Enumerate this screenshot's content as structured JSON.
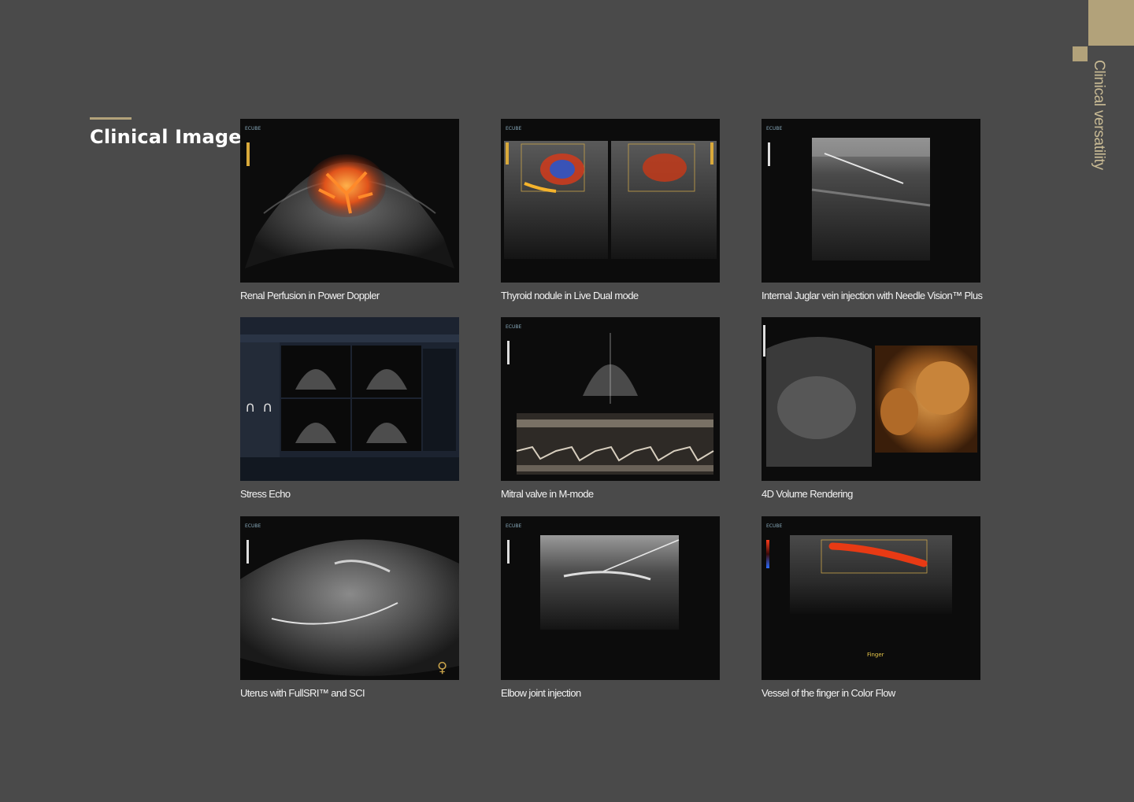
{
  "side_tab": {
    "label": "Clinical versatility"
  },
  "section": {
    "title": "Clinical Image"
  },
  "images": [
    {
      "caption": "Renal Perfusion in Power Doppler",
      "brand": "ECUBE",
      "icon": "ultrasound-scan"
    },
    {
      "caption": "Thyroid nodule in Live Dual mode",
      "brand": "ECUBE",
      "icon": "ultrasound-scan"
    },
    {
      "caption": "Internal Juglar vein injection with Needle Vision™ Plus",
      "brand": "ECUBE",
      "icon": "ultrasound-scan"
    },
    {
      "caption": "Stress Echo",
      "icon": "ultrasound-scan"
    },
    {
      "caption": "Mitral valve in M-mode",
      "brand": "ECUBE",
      "icon": "ultrasound-scan"
    },
    {
      "caption": "4D Volume Rendering",
      "icon": "ultrasound-scan"
    },
    {
      "caption": "Uterus with FullSRI™ and SCI",
      "brand": "ECUBE",
      "icon": "ultrasound-scan"
    },
    {
      "caption": "Elbow joint injection",
      "brand": "ECUBE",
      "icon": "ultrasound-scan"
    },
    {
      "caption": "Vessel of the finger in Color Flow",
      "brand": "ECUBE",
      "icon": "ultrasound-scan",
      "label": "Finger"
    }
  ],
  "colors": {
    "accent": "#b2a27a",
    "background": "#4a4a4a",
    "image_bg": "#0c0c0c"
  }
}
